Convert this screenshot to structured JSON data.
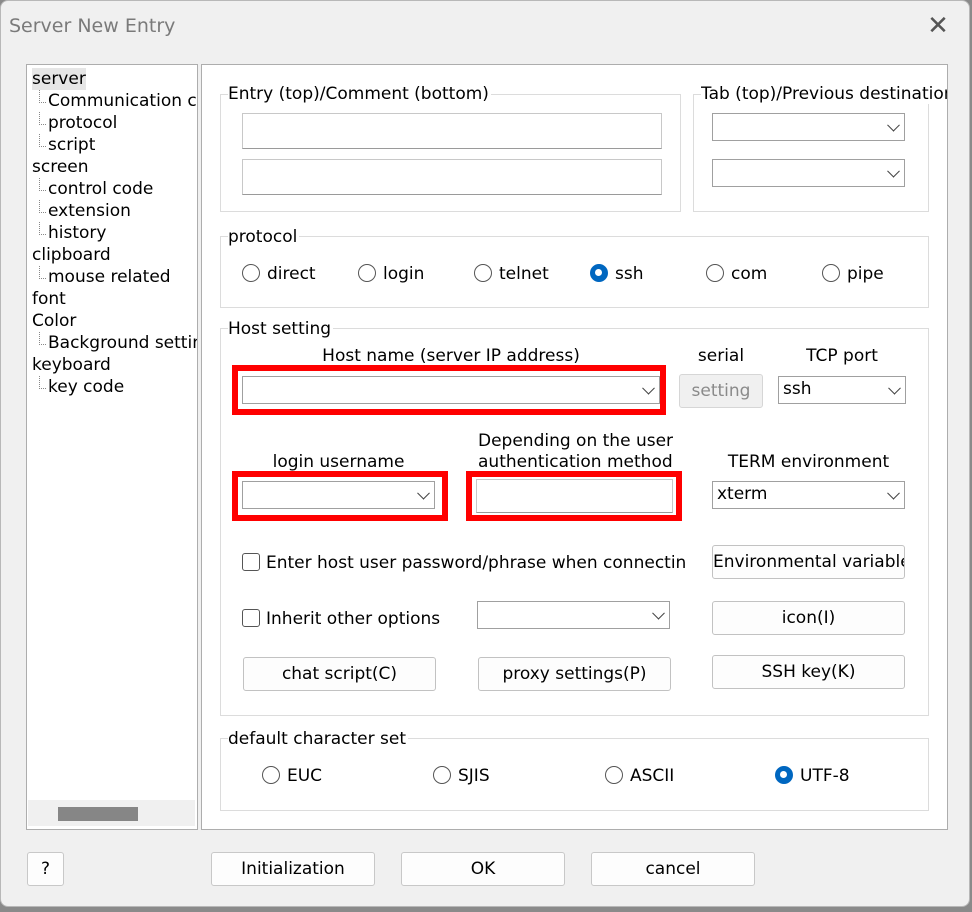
{
  "window": {
    "title": "Server New Entry",
    "close_glyph": "✕"
  },
  "tree": {
    "items": [
      {
        "label": "server",
        "level": 0,
        "selected": true
      },
      {
        "label": "Communication co",
        "level": 1
      },
      {
        "label": "protocol",
        "level": 1
      },
      {
        "label": "script",
        "level": 1
      },
      {
        "label": "screen",
        "level": 0
      },
      {
        "label": "control code",
        "level": 1
      },
      {
        "label": "extension",
        "level": 1
      },
      {
        "label": "history",
        "level": 1
      },
      {
        "label": "clipboard",
        "level": 0
      },
      {
        "label": "mouse related",
        "level": 1
      },
      {
        "label": "font",
        "level": 0
      },
      {
        "label": "Color",
        "level": 0
      },
      {
        "label": "Background settin",
        "level": 1
      },
      {
        "label": "keyboard",
        "level": 0
      },
      {
        "label": "key code",
        "level": 1
      }
    ]
  },
  "entry": {
    "group_label": "Entry (top)/Comment (bottom)",
    "entry_value": "",
    "comment_value": ""
  },
  "tab": {
    "group_label": "Tab (top)/Previous destination",
    "tab_value": "",
    "previous_value": ""
  },
  "protocol": {
    "group_label": "protocol",
    "options": [
      {
        "label": "direct",
        "selected": false
      },
      {
        "label": "login",
        "selected": false
      },
      {
        "label": "telnet",
        "selected": false
      },
      {
        "label": "ssh",
        "selected": true
      },
      {
        "label": "com",
        "selected": false
      },
      {
        "label": "pipe",
        "selected": false
      }
    ]
  },
  "host": {
    "group_label": "Host setting",
    "hostname_label": "Host name (server IP address)",
    "hostname_value": "",
    "serial_label": "serial",
    "serial_button": "setting",
    "tcp_label": "TCP port",
    "tcp_value": "ssh",
    "login_label": "login username",
    "login_value": "",
    "auth_label_line1": "Depending on the user",
    "auth_label_line2": "authentication method",
    "auth_value": "",
    "term_label": "TERM environment",
    "term_value": "xterm",
    "password_check": "Enter host user password/phrase when connecting",
    "env_button": "Environmental variables(V)",
    "inherit_check": "Inherit other options",
    "inherit_value": "",
    "icon_button": "icon(I)",
    "chat_button": "chat script(C)",
    "proxy_button": "proxy settings(P)",
    "sshkey_button": "SSH key(K)"
  },
  "charset": {
    "group_label": "default character set",
    "options": [
      {
        "label": "EUC",
        "selected": false
      },
      {
        "label": "SJIS",
        "selected": false
      },
      {
        "label": "ASCII",
        "selected": false
      },
      {
        "label": "UTF-8",
        "selected": true
      }
    ]
  },
  "footer": {
    "help": "?",
    "init": "Initialization",
    "ok": "OK",
    "cancel": "cancel"
  },
  "colors": {
    "highlight": "#ff0000",
    "accent": "#0067c0"
  }
}
